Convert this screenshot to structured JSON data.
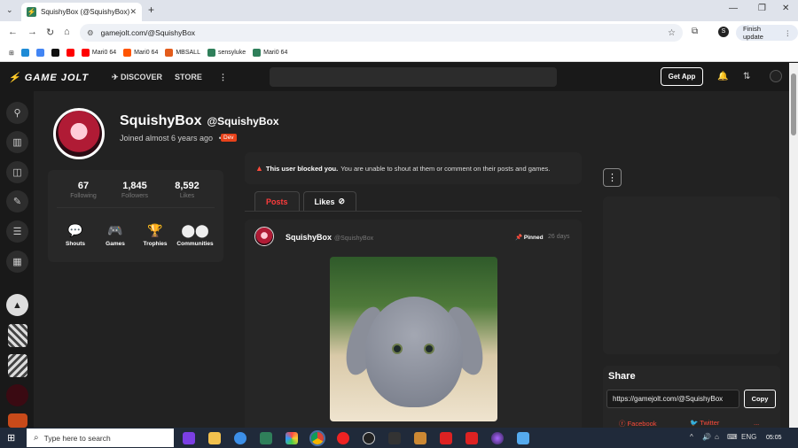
{
  "browser": {
    "tab_title": "SquishyBox (@SquishyBox) - G",
    "tab_close": "✕",
    "new_tab": "+",
    "url": "gamejolt.com/@SquishyBox",
    "finish_update": "Finish update",
    "profile_initial": "S",
    "bookmarks": [
      {
        "label": "",
        "color": "#1e8bd6"
      },
      {
        "label": "",
        "color": "#4285f4"
      },
      {
        "label": "",
        "color": "#111111"
      },
      {
        "label": "",
        "color": "#ff0000"
      },
      {
        "label": "Mari0 64",
        "color": "#ff0000"
      },
      {
        "label": "Mari0 64",
        "color": "#ff5500"
      },
      {
        "label": "MBSALL",
        "color": "#e35c1b"
      },
      {
        "label": "sensyluke",
        "color": "#2f7f5a"
      },
      {
        "label": "Mari0 64",
        "color": "#2f7f5a"
      }
    ]
  },
  "site": {
    "logo": "GAME JOLT",
    "nav_discover": "DISCOVER",
    "nav_store": "STORE",
    "get_app": "Get App"
  },
  "profile": {
    "name": "SquishyBox",
    "handle": "@SquishyBox",
    "joined": "Joined almost 6 years ago",
    "dot": "•",
    "dev_badge": "Dev",
    "stats": [
      {
        "value": "67",
        "label": "Following"
      },
      {
        "value": "1,845",
        "label": "Followers"
      },
      {
        "value": "8,592",
        "label": "Likes"
      }
    ],
    "quick_links": [
      {
        "label": "Shouts",
        "icon": "chat-icon"
      },
      {
        "label": "Games",
        "icon": "gamepad-icon"
      },
      {
        "label": "Trophies",
        "icon": "trophy-icon"
      },
      {
        "label": "Communities",
        "icon": "communities-icon"
      }
    ]
  },
  "blocked": {
    "bold": "This user blocked you.",
    "text": "You are unable to shout at them or comment on their posts and games."
  },
  "tabs": {
    "posts": "Posts",
    "likes": "Likes"
  },
  "post": {
    "author": "SquishyBox",
    "handle": "@SquishyBox",
    "pinned": "Pinned",
    "age": "26 days"
  },
  "share": {
    "title": "Share",
    "url": "https://gamejolt.com/@SquishyBox",
    "copy": "Copy",
    "facebook": "Facebook",
    "twitter": "Twitter",
    "more": "..."
  },
  "taskbar": {
    "search_placeholder": "Type here to search",
    "lang": "ENG",
    "time": "05:05"
  },
  "colors": {
    "accent": "#ff3c3c",
    "dev_badge": "#e8421a",
    "background": "#222222"
  }
}
